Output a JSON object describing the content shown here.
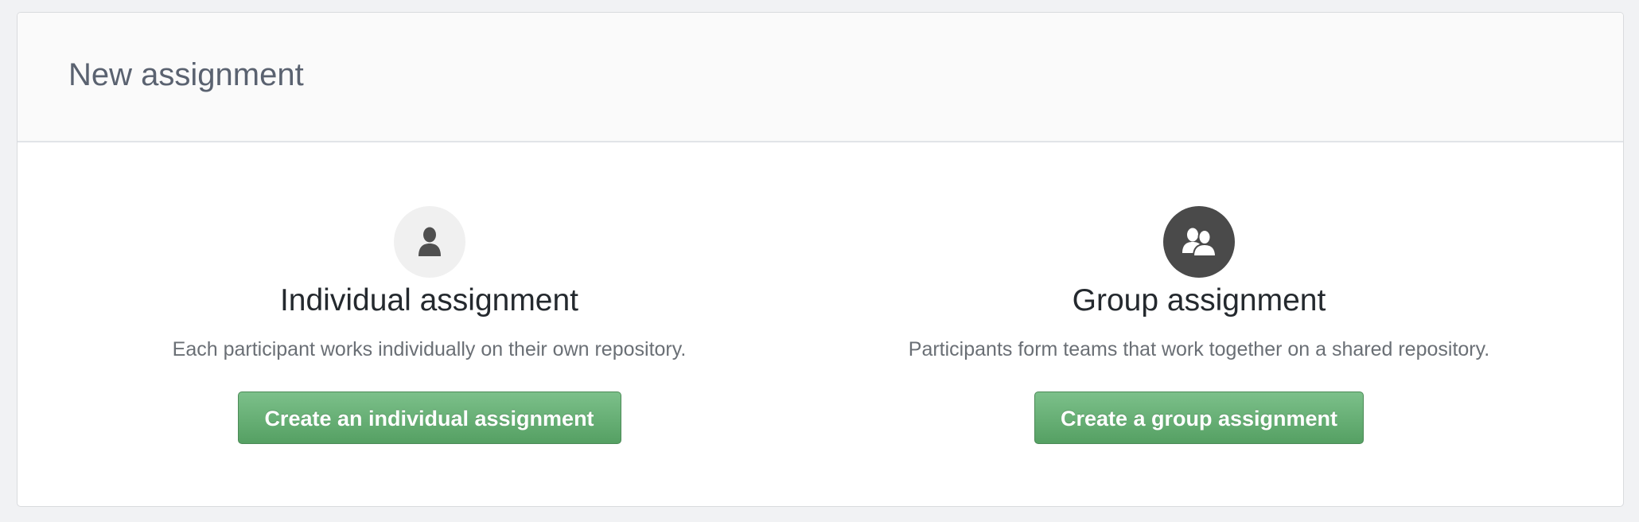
{
  "header": {
    "title": "New assignment"
  },
  "options": [
    {
      "icon": "person-icon",
      "title": "Individual assignment",
      "description": "Each participant works individually on their own repository.",
      "button_label": "Create an individual assignment"
    },
    {
      "icon": "people-icon",
      "title": "Group assignment",
      "description": "Participants form teams that work together on a shared repository.",
      "button_label": "Create a group assignment"
    }
  ],
  "colors": {
    "button_green": "#5fae6e",
    "dark_icon_bg": "#4a4a4a",
    "light_icon_bg": "#f0f0f0"
  }
}
